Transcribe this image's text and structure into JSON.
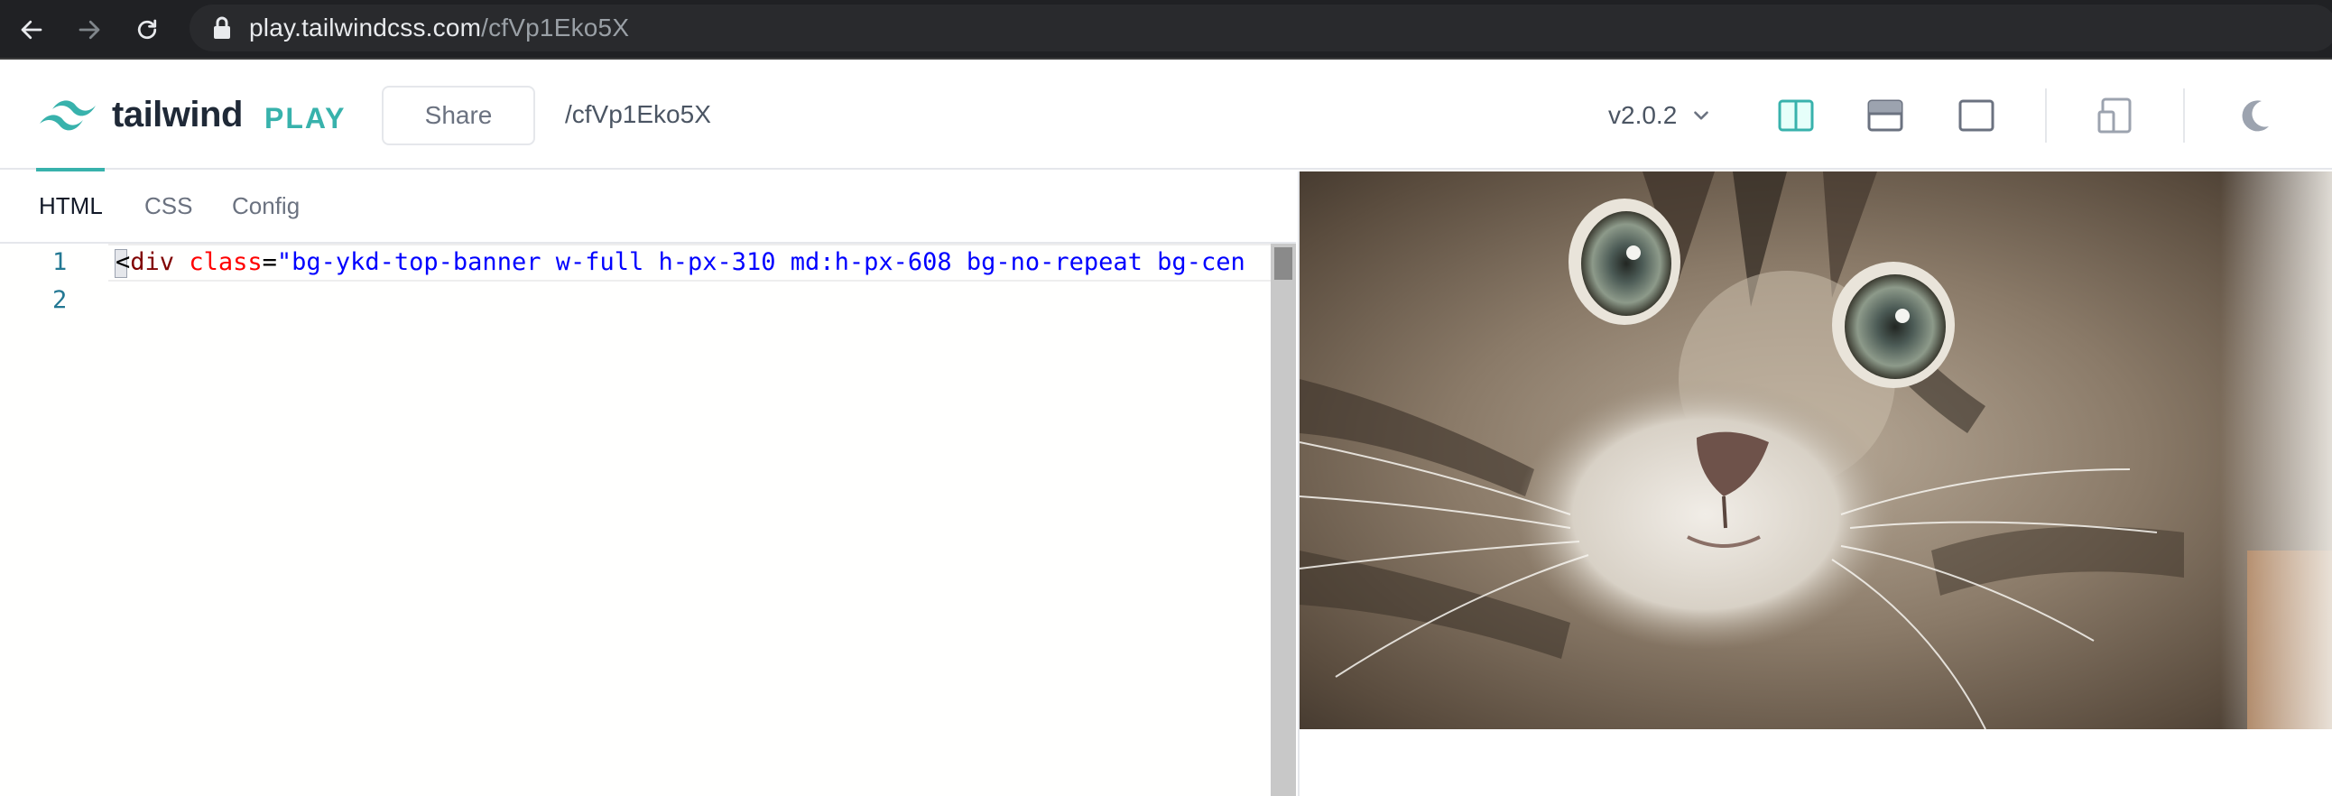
{
  "browser": {
    "url_host": "play.tailwindcss.com",
    "url_path": "/cfVp1Eko5X"
  },
  "header": {
    "logo_word": "tailwind",
    "logo_play": "PLAY",
    "share_label": "Share",
    "share_path": "/cfVp1Eko5X",
    "version": "v2.0.2",
    "accent_color": "#38b2ac"
  },
  "editor": {
    "tabs": [
      {
        "label": "HTML",
        "active": true
      },
      {
        "label": "CSS",
        "active": false
      },
      {
        "label": "Config",
        "active": false
      }
    ],
    "line_numbers": [
      "1",
      "2"
    ],
    "line1": {
      "open": "<",
      "tag": "div",
      "space": " ",
      "attr": "class",
      "eq": "=",
      "value": "\"bg-ykd-top-banner w-full h-px-310 md:h-px-608 bg-no-repeat bg-cen"
    }
  },
  "preview": {
    "image_subject": "tabby-kitten-face"
  },
  "icons": {
    "back": "arrow-left-icon",
    "forward": "arrow-right-icon",
    "reload": "reload-icon",
    "lock": "lock-icon",
    "layout_vertical": "split-vertical-icon",
    "layout_horizontal": "split-horizontal-icon",
    "layout_preview": "preview-only-icon",
    "responsive": "responsive-design-icon",
    "theme": "moon-icon",
    "version_chevron": "chevron-down-icon"
  }
}
